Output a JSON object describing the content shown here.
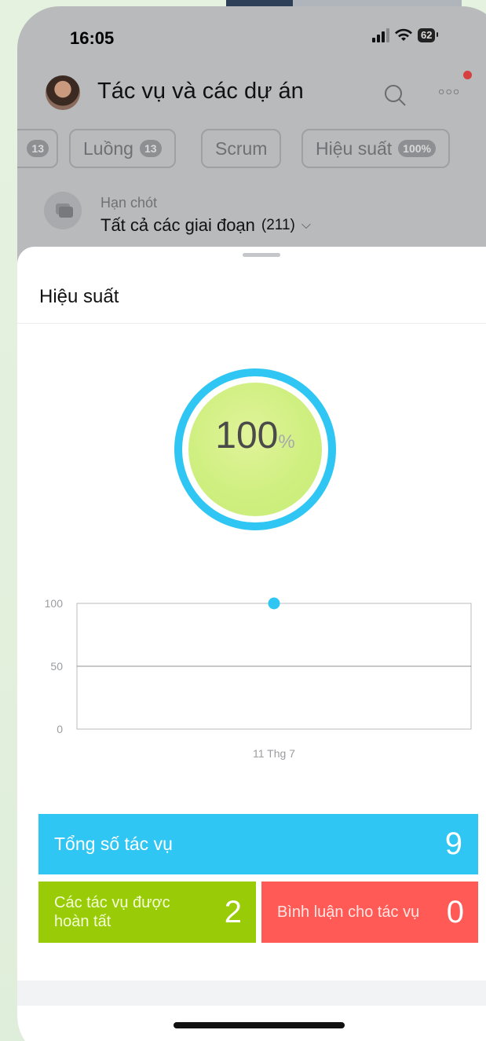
{
  "status_bar": {
    "time": "16:05",
    "battery": "62"
  },
  "header": {
    "title": "Tác vụ và các dự án",
    "search_icon": "search-icon",
    "more_icon": "more-icon"
  },
  "tabs": [
    {
      "label": "",
      "count": "13"
    },
    {
      "label": "Luồng",
      "count": "13"
    },
    {
      "label": "Scrum",
      "count": ""
    },
    {
      "label": "Hiệu suất",
      "count": "100%"
    }
  ],
  "filter": {
    "label": "Hạn chót",
    "stage": "Tất cả các giai đoạn",
    "stage_count": "(211)"
  },
  "sheet": {
    "title": "Hiệu suất",
    "score": "100",
    "score_unit": "%"
  },
  "chart_data": {
    "type": "line",
    "x": [
      "11 Thg 7"
    ],
    "series": [
      {
        "values": [
          100
        ]
      }
    ],
    "ylim": [
      0,
      100
    ],
    "yticks": [
      "100",
      "50",
      "0"
    ],
    "grid": true
  },
  "stats": {
    "total_label": "Tổng số tác vụ",
    "total_value": "9",
    "completed_label": "Các tác vụ được hoàn tất",
    "completed_value": "2",
    "comments_label": "Bình luận cho tác vụ",
    "comments_value": "0"
  },
  "colors": {
    "accent_blue": "#2fc6f4",
    "green": "#99cb06",
    "red": "#ff5a55",
    "notification": "#d64041"
  }
}
